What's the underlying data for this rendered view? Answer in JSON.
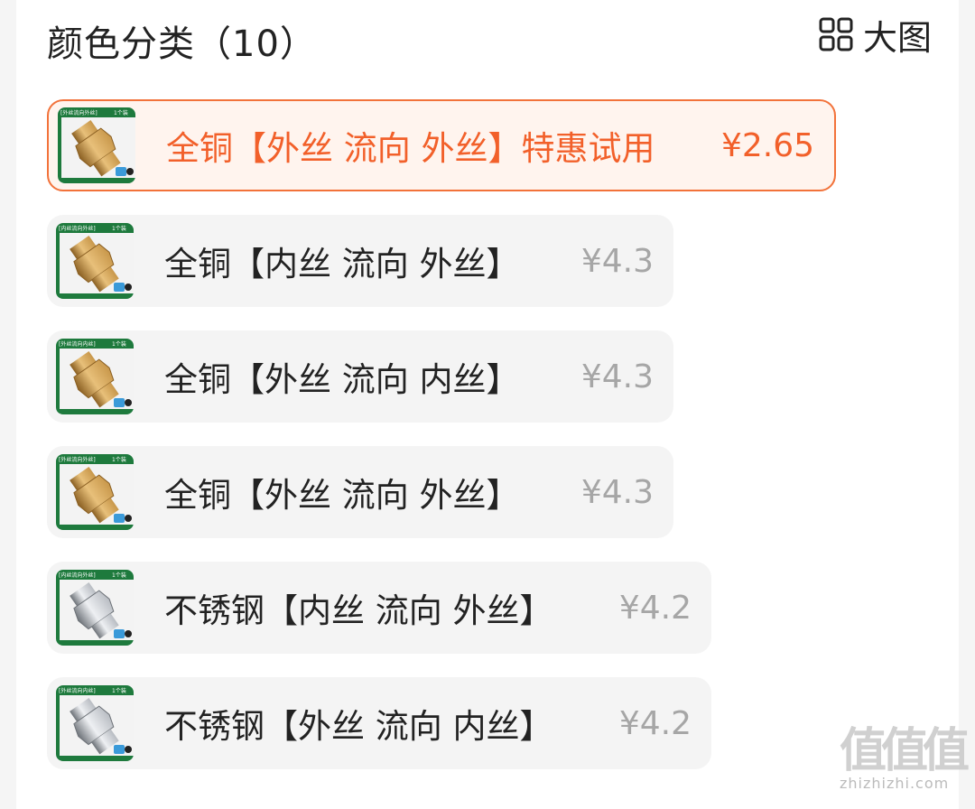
{
  "header": {
    "title": "颜色分类（10）",
    "view_label": "大图",
    "view_icon": "grid-view-icon"
  },
  "colors": {
    "accent": "#f2602a",
    "accent_bg": "#fff4ee",
    "item_bg": "#f4f4f4",
    "price_gray": "#a6a6a6",
    "thumb_green": "#1e7a3d"
  },
  "items": [
    {
      "label": "全铜【外丝 流向 外丝】特惠试用",
      "price": "¥2.65",
      "selected": true,
      "material": "brass",
      "thumb_caption": "[外丝流向外丝]",
      "thumb_count": "1个装"
    },
    {
      "label": "全铜【内丝 流向 外丝】",
      "price": "¥4.3",
      "selected": false,
      "material": "brass",
      "thumb_caption": "[内丝流向外丝]",
      "thumb_count": "1个装"
    },
    {
      "label": "全铜【外丝 流向 内丝】",
      "price": "¥4.3",
      "selected": false,
      "material": "brass",
      "thumb_caption": "[外丝流向内丝]",
      "thumb_count": "1个装"
    },
    {
      "label": "全铜【外丝 流向 外丝】",
      "price": "¥4.3",
      "selected": false,
      "material": "brass",
      "thumb_caption": "[外丝流向外丝]",
      "thumb_count": "1个装"
    },
    {
      "label": "不锈钢【内丝 流向 外丝】",
      "price": "¥4.2",
      "selected": false,
      "material": "steel",
      "thumb_caption": "[内丝流向外丝]",
      "thumb_count": "1个装"
    },
    {
      "label": "不锈钢【外丝 流向 内丝】",
      "price": "¥4.2",
      "selected": false,
      "material": "steel",
      "thumb_caption": "[外丝流向内丝]",
      "thumb_count": "1个装"
    }
  ],
  "watermark": {
    "logo": "值值值",
    "text": "zhizhizhi.com"
  }
}
